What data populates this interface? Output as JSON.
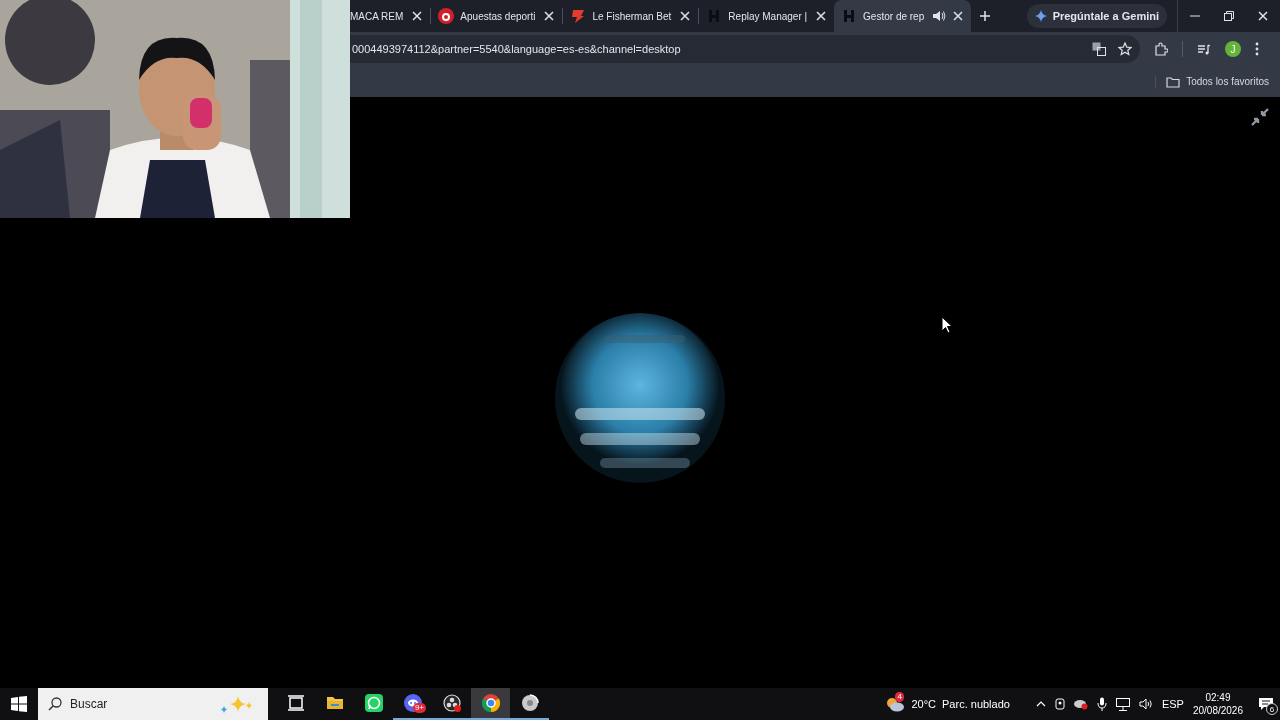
{
  "tabs": [
    {
      "title": "MACA REM",
      "kind": "plain",
      "selected": false,
      "audio": false
    },
    {
      "title": "Apuestas deporti",
      "kind": "circle",
      "selected": false,
      "audio": false
    },
    {
      "title": "Le Fisherman Bet",
      "kind": "flame",
      "selected": false,
      "audio": false
    },
    {
      "title": "Replay Manager |",
      "kind": "mark",
      "selected": false,
      "audio": false
    },
    {
      "title": "Gestor de rep",
      "kind": "mark",
      "selected": true,
      "audio": true
    }
  ],
  "gemini_button": "Pregúntale a Gemini",
  "address_bar": {
    "url": "0004493974112&partner=5540&language=es-es&channel=desktop"
  },
  "profile": {
    "initial": "J"
  },
  "bookmarks_bar": {
    "all_bookmarks": "Todos los favoritos"
  },
  "taskbar": {
    "search_placeholder": "Buscar",
    "apps": [
      {
        "kind": "task-view",
        "running": false,
        "selected": false
      },
      {
        "kind": "folder",
        "running": false,
        "selected": false
      },
      {
        "kind": "chat",
        "running": false,
        "selected": false
      },
      {
        "kind": "discord",
        "running": true,
        "selected": false,
        "badge": "9+"
      },
      {
        "kind": "recorder",
        "running": true,
        "selected": false
      },
      {
        "kind": "browser",
        "running": true,
        "selected": true
      },
      {
        "kind": "disc",
        "running": true,
        "selected": false
      }
    ],
    "weather": {
      "badge": "4",
      "temperature": "20°C",
      "condition": "Parc. nublado"
    },
    "language": "ESP",
    "time": "02:49",
    "date": "20/08/2026",
    "notifications": "6"
  }
}
